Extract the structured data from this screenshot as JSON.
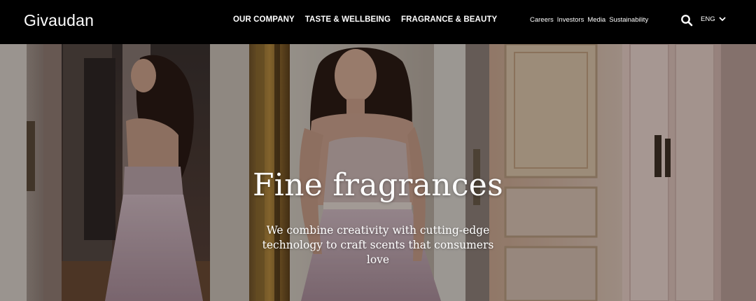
{
  "brand": {
    "logo_text": "Givaudan"
  },
  "main_nav": [
    {
      "label": "OUR COMPANY"
    },
    {
      "label": "TASTE & WELLBEING"
    },
    {
      "label": "FRAGRANCE & BEAUTY"
    }
  ],
  "utility_nav": [
    {
      "label": "Careers"
    },
    {
      "label": "Investors"
    },
    {
      "label": "Media"
    },
    {
      "label": "Sustainability"
    }
  ],
  "search": {
    "icon": "search-icon"
  },
  "language": {
    "label": "ENG",
    "icon": "chevron-down-icon"
  },
  "hero": {
    "title": "Fine fragrances",
    "subtitle": "We combine creativity with cutting-edge technology to craft scents that consumers love"
  },
  "colors": {
    "header_bg": "#000000",
    "header_text": "#ffffff",
    "hero_text": "#ffffff"
  }
}
